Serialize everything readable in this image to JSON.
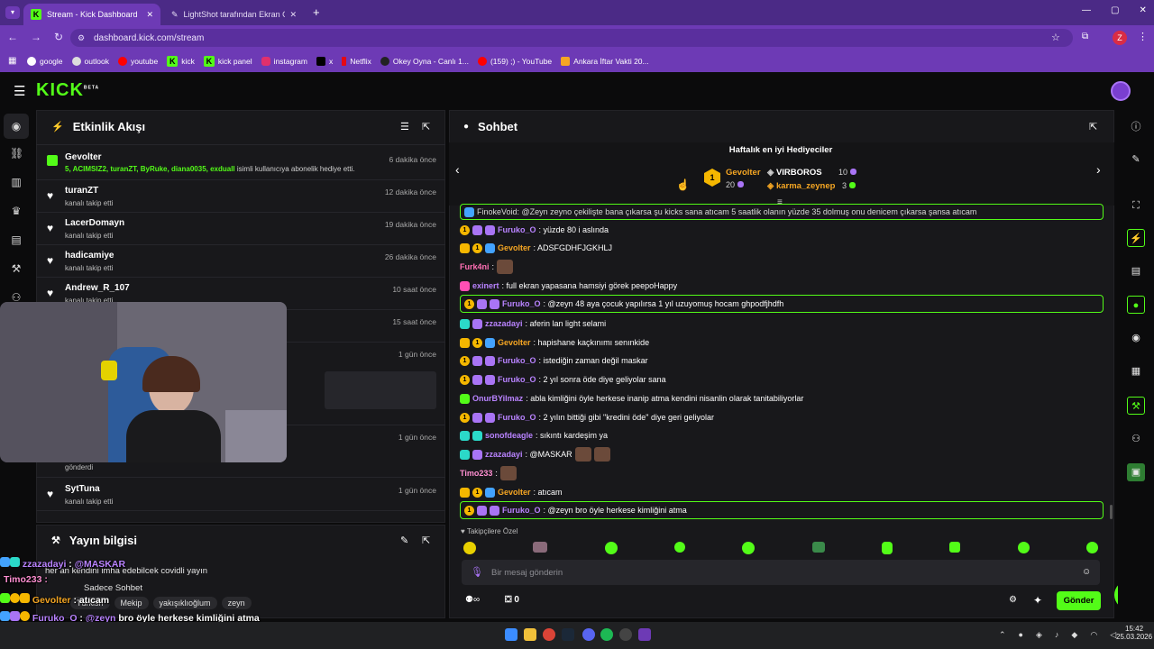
{
  "browser": {
    "tab1": "Stream - Kick Dashboard",
    "tab2": "LightShot tarafından Ekran Gör...",
    "url": "dashboard.kick.com/stream",
    "profile": "Z",
    "bookmarks": [
      "google",
      "outlook",
      "youtube",
      "kick",
      "kick panel",
      "instagram",
      "x",
      "Netflix",
      "Okey Oyna - Canlı 1...",
      "(159) ;) - YouTube",
      "Ankara İftar Vakti 20..."
    ]
  },
  "app": {
    "logo": "KICK",
    "logo_sup": "BETA"
  },
  "activity": {
    "title": "Etkinlik Akışı",
    "first": {
      "name": "Gevolter",
      "time": "6 dakika önce",
      "gift_users": "5, ACIMSIZ2, turanZT, ByRuke, diana0035, exduall",
      "gift_text": " isimli kullanıcıya abonelik hediye etti."
    },
    "items": [
      {
        "name": "turanZT",
        "sub": "kanalı takip etti",
        "time": "12 dakika önce"
      },
      {
        "name": "LacerDomayn",
        "sub": "kanalı takip etti",
        "time": "19 dakika önce"
      },
      {
        "name": "hadicamiye",
        "sub": "kanalı takip etti",
        "time": "26 dakika önce"
      },
      {
        "name": "Andrew_R_107",
        "sub": "kanalı takip etti",
        "time": "10 saat önce"
      }
    ],
    "hidden_times": [
      "15 saat önce",
      "1 gün önce",
      "1 gün önce"
    ],
    "gonderdi": "gönderdi",
    "last": {
      "name": "SytTuna",
      "sub": "kanalı takip etti",
      "time": "1 gün önce"
    }
  },
  "streaminfo": {
    "title": "Yayın bilgisi",
    "stream_title": "her an kendini imha edebilcek covidli yayın",
    "mode": "Sadece Sohbet",
    "tags": [
      "Türkish",
      "Mekip",
      "yakışıklıoğlum",
      "zeyn"
    ]
  },
  "chat": {
    "title": "Sohbet",
    "gifters_title": "Haftalık en iyi Hediyeciler",
    "top1": {
      "rank": "1",
      "name": "Gevolter",
      "count": "20"
    },
    "top2": {
      "name": "VIRBOROS",
      "count": "10"
    },
    "top3": {
      "name": "karma_zeynep",
      "count": "3"
    },
    "pinned": "FinokeVoid: @Zeyn zeyno çekilişte bana çıkarsa şu kicks sana atıcam 5 saatlik olanın yüzde 35 dolmuş onu denicem çıkarsa şansa atıcam",
    "messages": [
      {
        "user": "Furuko_O",
        "color": "#b983ff",
        "text": ": yüzde 80 i aslında"
      },
      {
        "user": "Gevolter",
        "color": "#f5a623",
        "text": ": ADSFGDHFJGKHLJ"
      },
      {
        "user": "Furk4ni",
        "color": "#ff6fb4",
        "text": ":"
      },
      {
        "user": "exinert",
        "color": "#b983ff",
        "text": ": full ekran yapasana hamsiyi görek peepoHappy"
      },
      {
        "user": "Furuko_O",
        "color": "#b983ff",
        "text": ": @zeyn 48 aya çocuk yapılırsa 1 yıl uzuyomuş hocam ghpodfjhdfh"
      },
      {
        "user": "zzazadayi",
        "color": "#b983ff",
        "text": ": aferin lan light selami"
      },
      {
        "user": "Gevolter",
        "color": "#f5a623",
        "text": ": hapishane kaçkınımı senınkide"
      },
      {
        "user": "Furuko_O",
        "color": "#b983ff",
        "text": ": istediğin zaman değil maskar"
      },
      {
        "user": "Furuko_O",
        "color": "#b983ff",
        "text": ": 2 yıl sonra öde diye geliyolar sana"
      },
      {
        "user": "OnurBYilmaz",
        "color": "#b983ff",
        "text": ": abla kimliğini öyle herkese inanip atma kendini nisanlin olarak tanitabiliyorlar"
      },
      {
        "user": "Furuko_O",
        "color": "#b983ff",
        "text": ": 2 yılın bittiği gibi \"kredini öde\" diye geri geliyolar"
      },
      {
        "user": "sonofdeagle",
        "color": "#b983ff",
        "text": ": sıkıntı kardeşim ya"
      },
      {
        "user": "zzazadayi",
        "color": "#b983ff",
        "text": ": @MASKAR"
      },
      {
        "user": "Timo233",
        "color": "#ff8fd1",
        "text": ":"
      },
      {
        "user": "Gevolter",
        "color": "#f5a623",
        "text": ": atıcam"
      },
      {
        "user": "Furuko_O",
        "color": "#b983ff",
        "text": ": @zeyn bro öyle herkese kimliğini atma"
      }
    ],
    "followers_only": "Takipçilere Özel",
    "input_placeholder": "Bir mesaj gönderin",
    "points": "0",
    "send": "Gönder"
  },
  "overlay": {
    "l1_user": "zzazadayi",
    "l1_text": "@MASKAR",
    "l2_user": "Timo233",
    "l3_user": "Gevolter",
    "l3_text": "atıcam",
    "l4_user": "Furuko_O",
    "l4_mention": "@zeyn",
    "l4_text": "bro öyle herkese kimliğini atma"
  },
  "taskbar": {
    "time": "15:42",
    "date": "25.03.2026"
  }
}
